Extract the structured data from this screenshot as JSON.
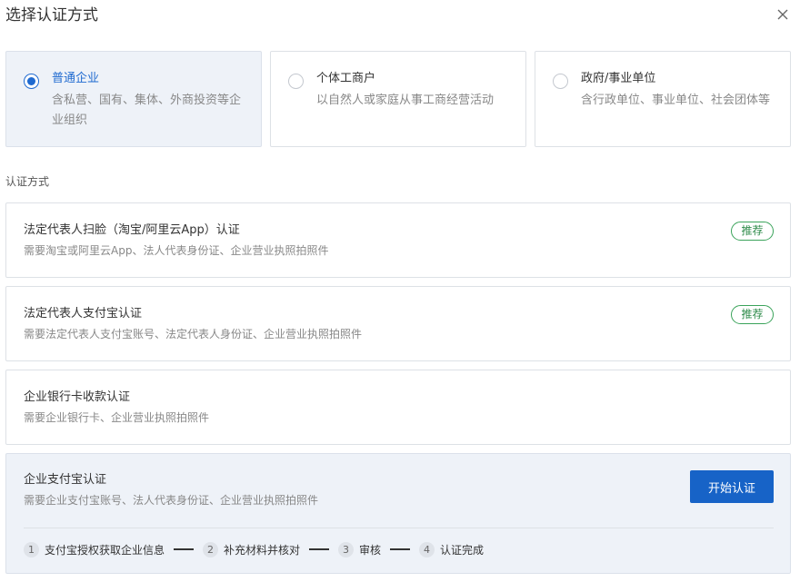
{
  "dialog": {
    "title": "选择认证方式"
  },
  "entity_types": [
    {
      "title": "普通企业",
      "desc": "含私营、国有、集体、外商投资等企业组织",
      "selected": true
    },
    {
      "title": "个体工商户",
      "desc": "以自然人或家庭从事工商经营活动",
      "selected": false
    },
    {
      "title": "政府/事业单位",
      "desc": "含行政单位、事业单位、社会团体等",
      "selected": false
    }
  ],
  "methods_section": {
    "label": "认证方式"
  },
  "methods": [
    {
      "title": "法定代表人扫脸（淘宝/阿里云App）认证",
      "desc": "需要淘宝或阿里云App、法人代表身份证、企业营业执照拍照件",
      "badge": "推荐"
    },
    {
      "title": "法定代表人支付宝认证",
      "desc": "需要法定代表人支付宝账号、法定代表人身份证、企业营业执照拍照件",
      "badge": "推荐"
    },
    {
      "title": "企业银行卡收款认证",
      "desc": "需要企业银行卡、企业营业执照拍照件",
      "badge": ""
    },
    {
      "title": "企业支付宝认证",
      "desc": "需要企业支付宝账号、法人代表身份证、企业营业执照拍照件",
      "badge": "",
      "action": "开始认证",
      "steps": [
        {
          "num": "1",
          "label": "支付宝授权获取企业信息"
        },
        {
          "num": "2",
          "label": "补充材料并核对"
        },
        {
          "num": "3",
          "label": "审核"
        },
        {
          "num": "4",
          "label": "认证完成"
        }
      ]
    }
  ],
  "colors": {
    "accent": "#1f6ad0",
    "button": "#1763c7",
    "badge": "#3aa35a",
    "selected_bg": "#eef2f8"
  },
  "icons": {
    "close": "close-icon",
    "radio_checked": "radio-checked-icon",
    "radio_unchecked": "radio-unchecked-icon"
  }
}
